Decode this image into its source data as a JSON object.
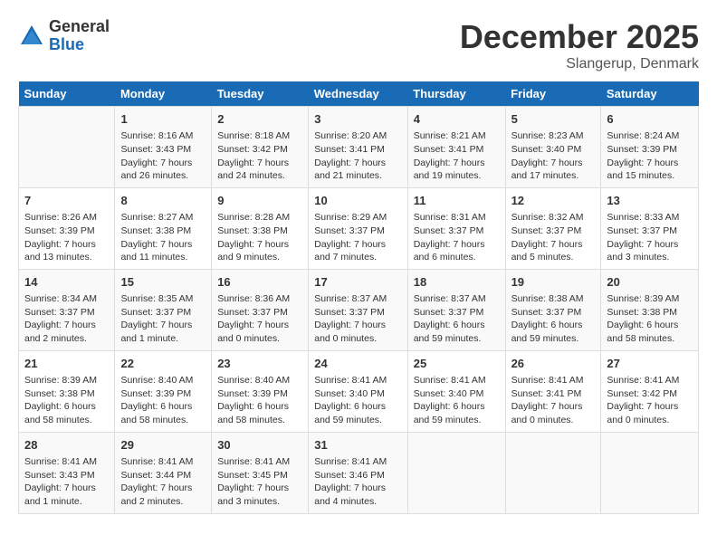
{
  "logo": {
    "general": "General",
    "blue": "Blue"
  },
  "title": "December 2025",
  "location": "Slangerup, Denmark",
  "weekdays": [
    "Sunday",
    "Monday",
    "Tuesday",
    "Wednesday",
    "Thursday",
    "Friday",
    "Saturday"
  ],
  "weeks": [
    [
      {
        "day": "",
        "sunrise": "",
        "sunset": "",
        "daylight": ""
      },
      {
        "day": "1",
        "sunrise": "Sunrise: 8:16 AM",
        "sunset": "Sunset: 3:43 PM",
        "daylight": "Daylight: 7 hours and 26 minutes."
      },
      {
        "day": "2",
        "sunrise": "Sunrise: 8:18 AM",
        "sunset": "Sunset: 3:42 PM",
        "daylight": "Daylight: 7 hours and 24 minutes."
      },
      {
        "day": "3",
        "sunrise": "Sunrise: 8:20 AM",
        "sunset": "Sunset: 3:41 PM",
        "daylight": "Daylight: 7 hours and 21 minutes."
      },
      {
        "day": "4",
        "sunrise": "Sunrise: 8:21 AM",
        "sunset": "Sunset: 3:41 PM",
        "daylight": "Daylight: 7 hours and 19 minutes."
      },
      {
        "day": "5",
        "sunrise": "Sunrise: 8:23 AM",
        "sunset": "Sunset: 3:40 PM",
        "daylight": "Daylight: 7 hours and 17 minutes."
      },
      {
        "day": "6",
        "sunrise": "Sunrise: 8:24 AM",
        "sunset": "Sunset: 3:39 PM",
        "daylight": "Daylight: 7 hours and 15 minutes."
      }
    ],
    [
      {
        "day": "7",
        "sunrise": "Sunrise: 8:26 AM",
        "sunset": "Sunset: 3:39 PM",
        "daylight": "Daylight: 7 hours and 13 minutes."
      },
      {
        "day": "8",
        "sunrise": "Sunrise: 8:27 AM",
        "sunset": "Sunset: 3:38 PM",
        "daylight": "Daylight: 7 hours and 11 minutes."
      },
      {
        "day": "9",
        "sunrise": "Sunrise: 8:28 AM",
        "sunset": "Sunset: 3:38 PM",
        "daylight": "Daylight: 7 hours and 9 minutes."
      },
      {
        "day": "10",
        "sunrise": "Sunrise: 8:29 AM",
        "sunset": "Sunset: 3:37 PM",
        "daylight": "Daylight: 7 hours and 7 minutes."
      },
      {
        "day": "11",
        "sunrise": "Sunrise: 8:31 AM",
        "sunset": "Sunset: 3:37 PM",
        "daylight": "Daylight: 7 hours and 6 minutes."
      },
      {
        "day": "12",
        "sunrise": "Sunrise: 8:32 AM",
        "sunset": "Sunset: 3:37 PM",
        "daylight": "Daylight: 7 hours and 5 minutes."
      },
      {
        "day": "13",
        "sunrise": "Sunrise: 8:33 AM",
        "sunset": "Sunset: 3:37 PM",
        "daylight": "Daylight: 7 hours and 3 minutes."
      }
    ],
    [
      {
        "day": "14",
        "sunrise": "Sunrise: 8:34 AM",
        "sunset": "Sunset: 3:37 PM",
        "daylight": "Daylight: 7 hours and 2 minutes."
      },
      {
        "day": "15",
        "sunrise": "Sunrise: 8:35 AM",
        "sunset": "Sunset: 3:37 PM",
        "daylight": "Daylight: 7 hours and 1 minute."
      },
      {
        "day": "16",
        "sunrise": "Sunrise: 8:36 AM",
        "sunset": "Sunset: 3:37 PM",
        "daylight": "Daylight: 7 hours and 0 minutes."
      },
      {
        "day": "17",
        "sunrise": "Sunrise: 8:37 AM",
        "sunset": "Sunset: 3:37 PM",
        "daylight": "Daylight: 7 hours and 0 minutes."
      },
      {
        "day": "18",
        "sunrise": "Sunrise: 8:37 AM",
        "sunset": "Sunset: 3:37 PM",
        "daylight": "Daylight: 6 hours and 59 minutes."
      },
      {
        "day": "19",
        "sunrise": "Sunrise: 8:38 AM",
        "sunset": "Sunset: 3:37 PM",
        "daylight": "Daylight: 6 hours and 59 minutes."
      },
      {
        "day": "20",
        "sunrise": "Sunrise: 8:39 AM",
        "sunset": "Sunset: 3:38 PM",
        "daylight": "Daylight: 6 hours and 58 minutes."
      }
    ],
    [
      {
        "day": "21",
        "sunrise": "Sunrise: 8:39 AM",
        "sunset": "Sunset: 3:38 PM",
        "daylight": "Daylight: 6 hours and 58 minutes."
      },
      {
        "day": "22",
        "sunrise": "Sunrise: 8:40 AM",
        "sunset": "Sunset: 3:39 PM",
        "daylight": "Daylight: 6 hours and 58 minutes."
      },
      {
        "day": "23",
        "sunrise": "Sunrise: 8:40 AM",
        "sunset": "Sunset: 3:39 PM",
        "daylight": "Daylight: 6 hours and 58 minutes."
      },
      {
        "day": "24",
        "sunrise": "Sunrise: 8:41 AM",
        "sunset": "Sunset: 3:40 PM",
        "daylight": "Daylight: 6 hours and 59 minutes."
      },
      {
        "day": "25",
        "sunrise": "Sunrise: 8:41 AM",
        "sunset": "Sunset: 3:40 PM",
        "daylight": "Daylight: 6 hours and 59 minutes."
      },
      {
        "day": "26",
        "sunrise": "Sunrise: 8:41 AM",
        "sunset": "Sunset: 3:41 PM",
        "daylight": "Daylight: 7 hours and 0 minutes."
      },
      {
        "day": "27",
        "sunrise": "Sunrise: 8:41 AM",
        "sunset": "Sunset: 3:42 PM",
        "daylight": "Daylight: 7 hours and 0 minutes."
      }
    ],
    [
      {
        "day": "28",
        "sunrise": "Sunrise: 8:41 AM",
        "sunset": "Sunset: 3:43 PM",
        "daylight": "Daylight: 7 hours and 1 minute."
      },
      {
        "day": "29",
        "sunrise": "Sunrise: 8:41 AM",
        "sunset": "Sunset: 3:44 PM",
        "daylight": "Daylight: 7 hours and 2 minutes."
      },
      {
        "day": "30",
        "sunrise": "Sunrise: 8:41 AM",
        "sunset": "Sunset: 3:45 PM",
        "daylight": "Daylight: 7 hours and 3 minutes."
      },
      {
        "day": "31",
        "sunrise": "Sunrise: 8:41 AM",
        "sunset": "Sunset: 3:46 PM",
        "daylight": "Daylight: 7 hours and 4 minutes."
      },
      {
        "day": "",
        "sunrise": "",
        "sunset": "",
        "daylight": ""
      },
      {
        "day": "",
        "sunrise": "",
        "sunset": "",
        "daylight": ""
      },
      {
        "day": "",
        "sunrise": "",
        "sunset": "",
        "daylight": ""
      }
    ]
  ]
}
